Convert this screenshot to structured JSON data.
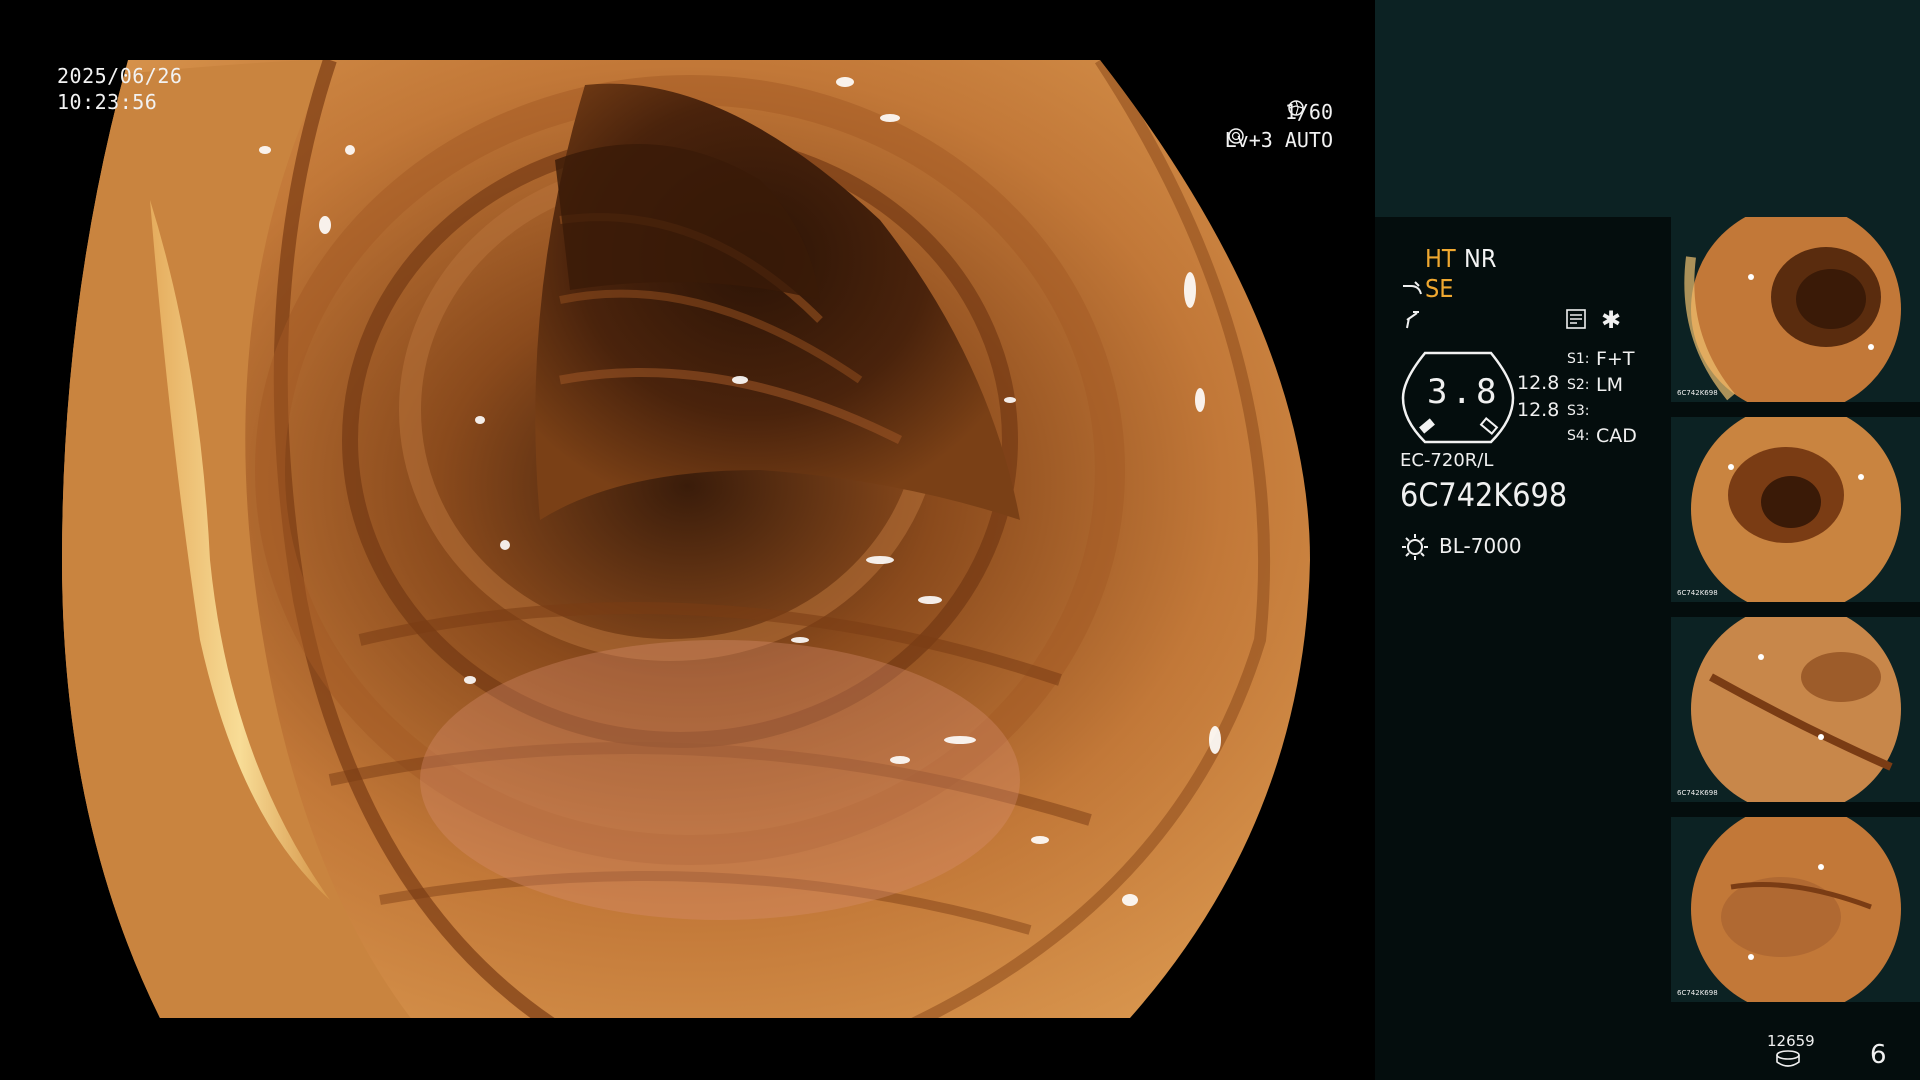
{
  "overlay": {
    "date": "2025/06/26",
    "time": "10:23:56",
    "shutter": "1/60",
    "level_mode": "Lv+3  AUTO"
  },
  "panel": {
    "modes": {
      "ht": "HT",
      "nr": "NR",
      "se": "SE"
    },
    "zoom_value": "3.8",
    "measure_1": "12.8",
    "measure_2": "12.8",
    "switches": [
      {
        "key": "S1:",
        "value": "F+T"
      },
      {
        "key": "S2:",
        "value": "LM"
      },
      {
        "key": "S3:",
        "value": ""
      },
      {
        "key": "S4:",
        "value": "CAD"
      }
    ],
    "scope_model": "EC-720R/L",
    "scope_serial": "6C742K698",
    "light_source": "BL-7000",
    "image_counter": "12659",
    "page_number": "6",
    "icons": [
      "scope-curve-icon",
      "lightning-icon",
      "memo-icon",
      "asterisk-icon",
      "light-bulb-icon",
      "storage-icon"
    ]
  },
  "thumbnails": [
    {
      "serial": "6C742K698"
    },
    {
      "serial": "6C742K698"
    },
    {
      "serial": "6C742K698"
    },
    {
      "serial": "6C742K698"
    }
  ],
  "colors": {
    "panel_bg": "#040d0d",
    "panel_top": "#0c2223",
    "accent_orange": "#f0a830",
    "mucosa": "#c77a35"
  }
}
